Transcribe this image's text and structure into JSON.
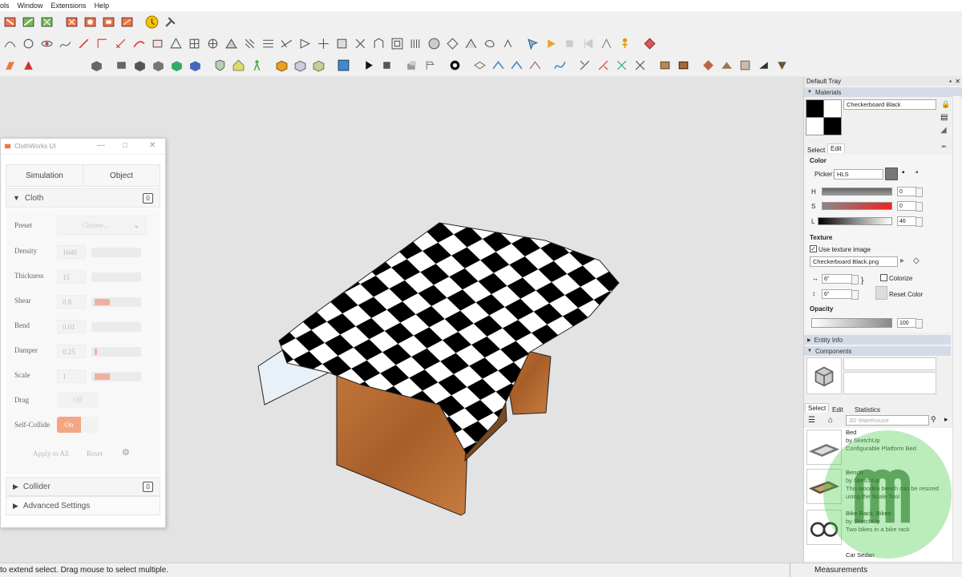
{
  "menubar": {
    "items": [
      "ols",
      "Window",
      "Extensions",
      "Help"
    ]
  },
  "cloth_panel": {
    "title": "ClothWorks UI",
    "tabs": [
      "Simulation",
      "Object"
    ],
    "sections": {
      "cloth": "Cloth",
      "collider": "Collider",
      "advanced": "Advanced Settings"
    },
    "badges": {
      "cloth": "0",
      "collider": "0"
    },
    "preset": {
      "label": "Preset",
      "placeholder": "Choose..."
    },
    "params": [
      {
        "label": "Density",
        "value": "1640",
        "fill": 0
      },
      {
        "label": "Thickness",
        "value": "15",
        "fill": 0
      },
      {
        "label": "Shear",
        "value": "0.8",
        "fill": 0.35
      },
      {
        "label": "Bend",
        "value": "0.01",
        "fill": 0
      },
      {
        "label": "Damper",
        "value": "0.25",
        "fill": 0.05
      },
      {
        "label": "Scale",
        "value": "1",
        "fill": 0.35
      }
    ],
    "drag": {
      "label": "Drag",
      "state": "Off"
    },
    "self_collide": {
      "label": "Self-Collide",
      "state": "On"
    },
    "buttons": {
      "apply_all": "Apply to All",
      "reset": "Reset"
    }
  },
  "tray": {
    "title": "Default Tray",
    "materials_header": "Materials",
    "material_name": "Checkerboard Black",
    "tabs": [
      "Select",
      "Edit"
    ],
    "color_label": "Color",
    "picker_label": "Picker:",
    "picker_value": "HLS",
    "h": {
      "label": "H",
      "value": "0"
    },
    "s": {
      "label": "S",
      "value": "0"
    },
    "l": {
      "label": "L",
      "value": "46"
    },
    "texture_label": "Texture",
    "use_texture": "Use texture image",
    "texture_file": "Checkerboard Black.png",
    "width": "6\"",
    "height": "6\"",
    "colorize": "Colorize",
    "reset_color": "Reset Color",
    "opacity_label": "Opacity",
    "opacity_value": "100",
    "entity_info": "Entity Info",
    "components": "Components",
    "comp_tabs": [
      "Select",
      "Edit",
      "Statistics"
    ],
    "search_placeholder": "3D Warehouse",
    "items": [
      {
        "name": "Bed",
        "by": "by SketchUp",
        "desc": "Configurable Platform Bed"
      },
      {
        "name": "Bench",
        "by": "by SketchUp",
        "desc": "This wooden bench can be resized using the Scale Tool"
      },
      {
        "name": "Bike Rack, Bikes",
        "by": "by SketchUp",
        "desc": "Two bikes in a bike rack"
      },
      {
        "name": "Car Sedan",
        "by": "",
        "desc": ""
      }
    ]
  },
  "status": {
    "hint": "to extend select. Drag mouse to select multiple.",
    "measurements": "Measurements"
  },
  "colors": {
    "accent": "#f6a584",
    "tray_header": "#d5dbe6",
    "wood": "#b86a32",
    "checker": "#000000"
  }
}
